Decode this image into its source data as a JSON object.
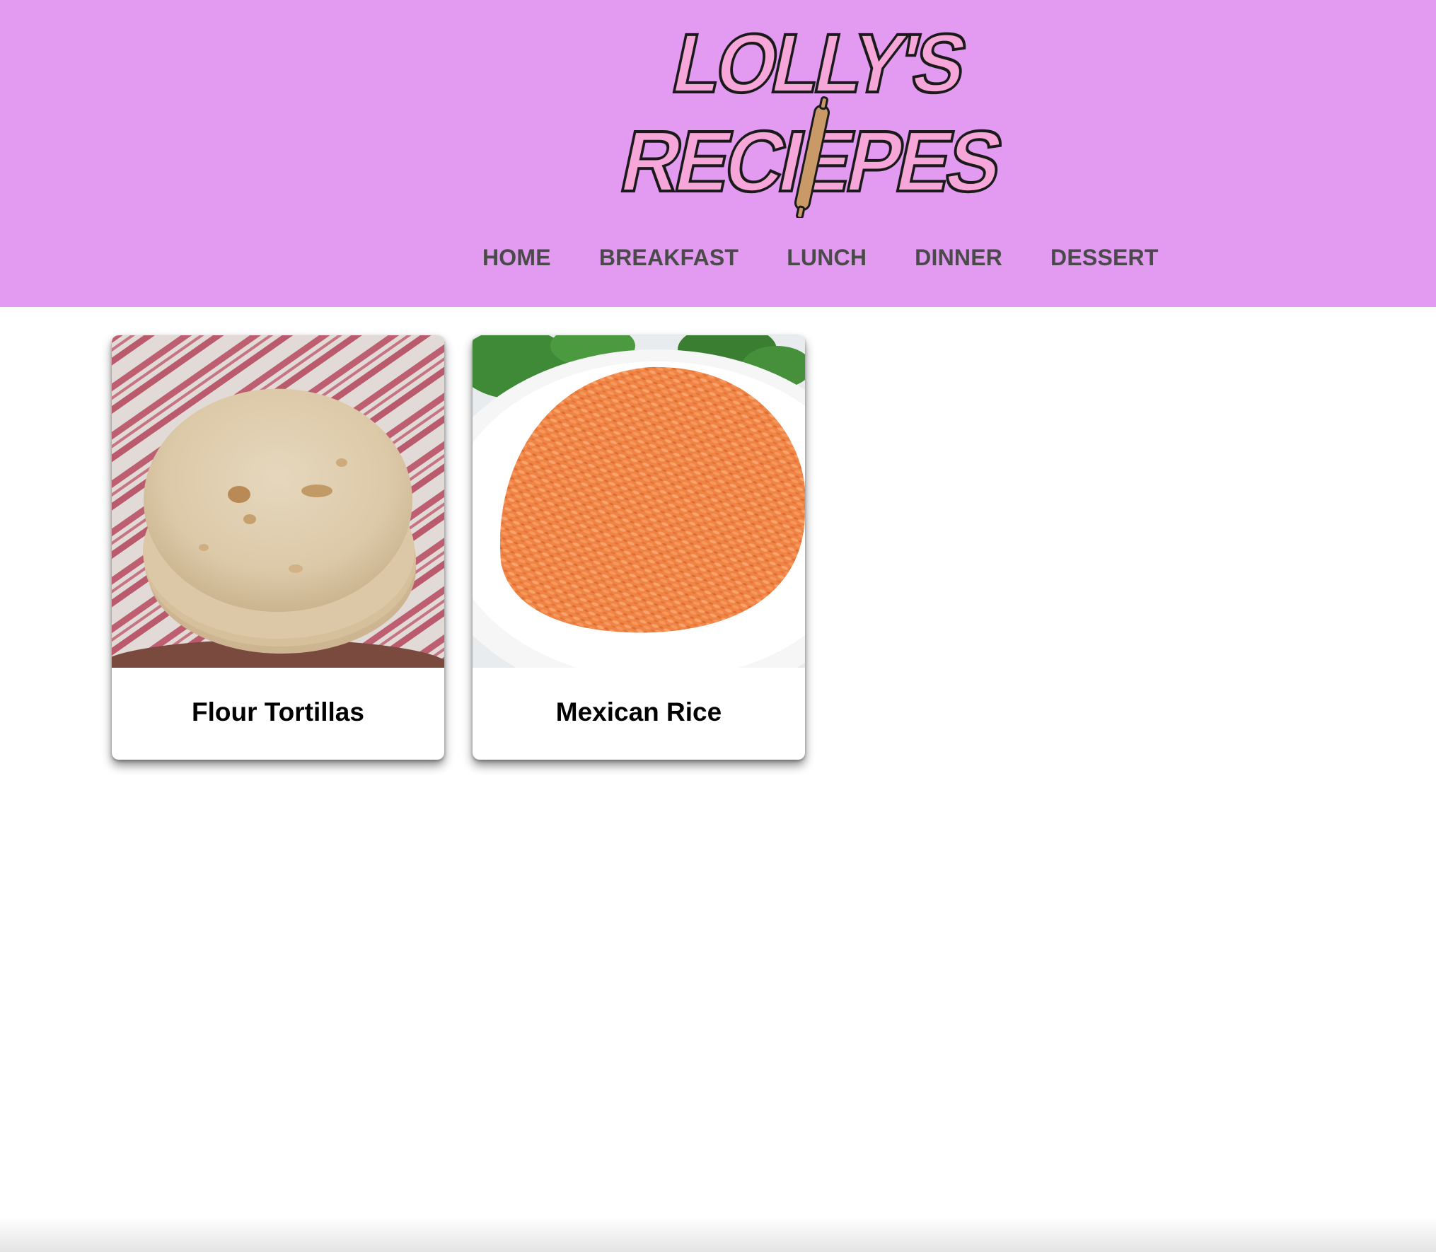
{
  "header": {
    "logo_text": "LOLLY'S RECIEPES",
    "background_color": "#e39af1",
    "logo_fill_color": "#f6a6d8"
  },
  "nav": {
    "items": [
      {
        "label": "HOME"
      },
      {
        "label": "BREAKFAST"
      },
      {
        "label": "LUNCH"
      },
      {
        "label": "DINNER"
      },
      {
        "label": "DESSERT"
      }
    ]
  },
  "recipes": [
    {
      "title": "Flour Tortillas",
      "image": "flour-tortillas-photo"
    },
    {
      "title": "Mexican Rice",
      "image": "mexican-rice-photo"
    }
  ]
}
